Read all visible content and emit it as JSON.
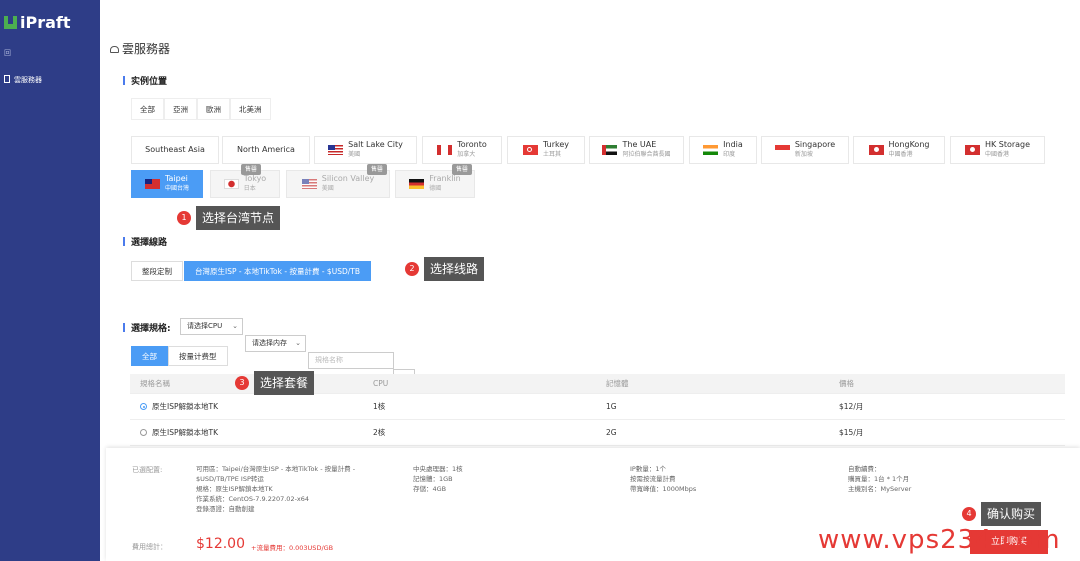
{
  "sidebar": {
    "logo_text": "iPraft",
    "sub_label": "回",
    "nav_item": "雲服務器"
  },
  "page": {
    "title": "雲服務器"
  },
  "location_section": {
    "title": "实例位置",
    "region_tabs": [
      "全部",
      "亞洲",
      "歐洲",
      "北美洲"
    ],
    "locations": [
      {
        "name": "Southeast Asia",
        "sub": ""
      },
      {
        "name": "North America",
        "sub": ""
      },
      {
        "name": "Salt Lake City",
        "sub": "美國"
      },
      {
        "name": "Toronto",
        "sub": "加拿大"
      },
      {
        "name": "Turkey",
        "sub": "土耳其"
      },
      {
        "name": "The UAE",
        "sub": "阿拉伯聯合酋長國"
      },
      {
        "name": "India",
        "sub": "印度"
      },
      {
        "name": "Singapore",
        "sub": "新加坡"
      },
      {
        "name": "HongKong",
        "sub": "中國香港"
      },
      {
        "name": "HK Storage",
        "sub": "中國香港"
      },
      {
        "name": "Taipei",
        "sub": "中國台灣"
      },
      {
        "name": "Tokyo",
        "sub": "日本",
        "badge": "售罄"
      },
      {
        "name": "Silicon Valley",
        "sub": "美國",
        "badge": "售罄"
      },
      {
        "name": "Franklin",
        "sub": "德國",
        "badge": "售罄"
      }
    ]
  },
  "callouts": [
    {
      "num": "1",
      "label": "选择台湾节点"
    },
    {
      "num": "2",
      "label": "选择线路"
    },
    {
      "num": "3",
      "label": "选择套餐"
    },
    {
      "num": "4",
      "label": "确认购买"
    }
  ],
  "line_section": {
    "title": "選擇線路",
    "options": [
      "整段定制",
      "台灣原生ISP - 本地TikTok - 按量計費 - $USD/TB"
    ]
  },
  "spec_section": {
    "title": "選擇規格:",
    "cpu_select": "请选择CPU",
    "mem_select": "请选择内存",
    "name_placeholder": "規格名称",
    "filter_tabs": [
      "全部",
      "按量计费型"
    ]
  },
  "table": {
    "headers": [
      "規格名稱",
      "CPU",
      "記憶體",
      "價格"
    ],
    "rows": [
      {
        "name": "原生ISP解鎖本地TK",
        "cpu": "1核",
        "mem": "1G",
        "price": "$12/月"
      },
      {
        "name": "原生ISP解鎖本地TK",
        "cpu": "2核",
        "mem": "2G",
        "price": "$15/月"
      }
    ]
  },
  "footer": {
    "config_label": "已選配置:",
    "col1": [
      "可用區：Taipei/台灣原生ISP - 本地TikTok - 按量計費 -",
      "$USD/TB/TPE ISP转运",
      "規格：原生ISP解鎖本地TK",
      "作業系統：CentOS-7.9.2207.02-x64",
      "登錄憑證：自動創建"
    ],
    "col2": [
      "中央處理器：1核",
      "記憶體：1GB",
      "存儲：4GB"
    ],
    "col3": [
      "IP數量：1个",
      "按需按流量計費",
      "帶寬峰值：1000Mbps"
    ],
    "col4": [
      "自動續費：",
      "購買量：1台 * 1个月",
      "主機別名：MyServer"
    ],
    "fee_label": "費用總計：",
    "price": "$12.00",
    "traffic_fee": "+流量費用：0.003USD/GB",
    "buy_button": "立即购买"
  },
  "watermark": "www.vps234.com"
}
